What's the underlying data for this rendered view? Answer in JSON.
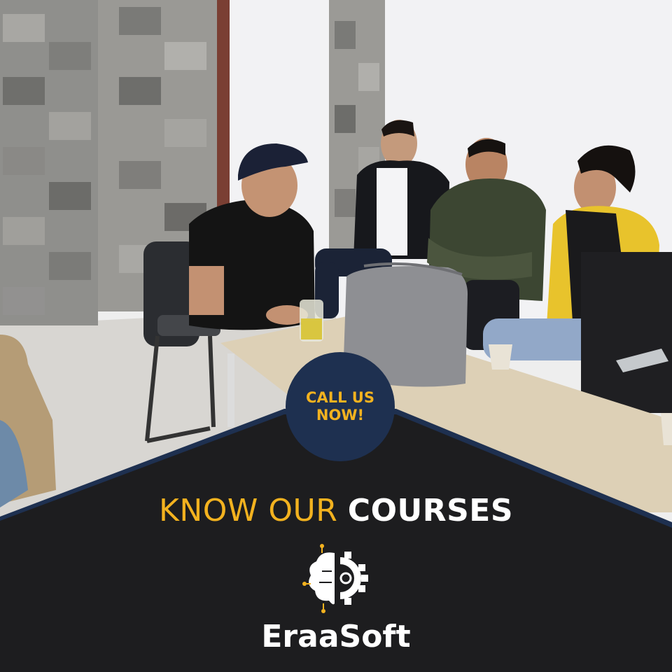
{
  "cta": {
    "line1": "CALL US",
    "line2": "NOW!"
  },
  "headline": {
    "part1": "KNOW OUR",
    "part2": "COURSES"
  },
  "brand": {
    "name": "EraaSoft",
    "logo_icon": "brain-gear-icon"
  },
  "colors": {
    "accent": "#f3b21f",
    "navy": "#1e3050",
    "panel": "#1d1d1f",
    "text": "#ffffff"
  }
}
